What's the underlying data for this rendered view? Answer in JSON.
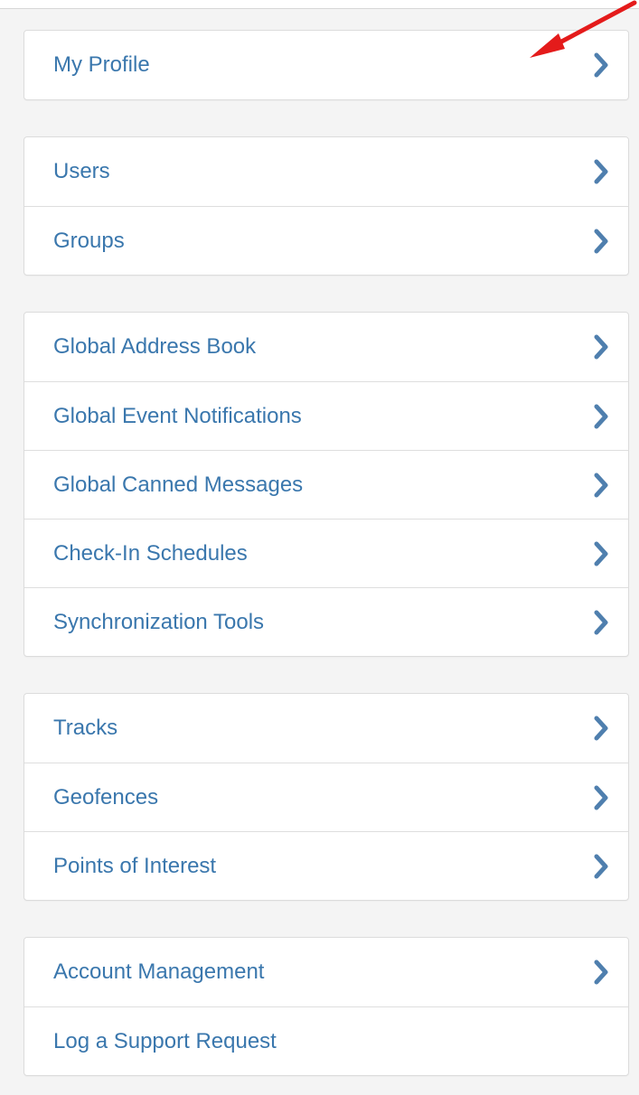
{
  "colors": {
    "link_text": "#3a77ad",
    "chevron": "#4f7fae",
    "annotation_arrow": "#e41b1b"
  },
  "groups": [
    {
      "items": [
        {
          "label": "My Profile",
          "has_chevron": true,
          "icon": "chevron-right-icon"
        }
      ]
    },
    {
      "items": [
        {
          "label": "Users",
          "has_chevron": true,
          "icon": "chevron-right-icon"
        },
        {
          "label": "Groups",
          "has_chevron": true,
          "icon": "chevron-right-icon"
        }
      ]
    },
    {
      "items": [
        {
          "label": "Global Address Book",
          "has_chevron": true,
          "icon": "chevron-right-icon"
        },
        {
          "label": "Global Event Notifications",
          "has_chevron": true,
          "icon": "chevron-right-icon"
        },
        {
          "label": "Global Canned Messages",
          "has_chevron": true,
          "icon": "chevron-right-icon"
        },
        {
          "label": "Check-In Schedules",
          "has_chevron": true,
          "icon": "chevron-right-icon"
        },
        {
          "label": "Synchronization Tools",
          "has_chevron": true,
          "icon": "chevron-right-icon"
        }
      ]
    },
    {
      "items": [
        {
          "label": "Tracks",
          "has_chevron": true,
          "icon": "chevron-right-icon"
        },
        {
          "label": "Geofences",
          "has_chevron": true,
          "icon": "chevron-right-icon"
        },
        {
          "label": "Points of Interest",
          "has_chevron": true,
          "icon": "chevron-right-icon"
        }
      ]
    },
    {
      "items": [
        {
          "label": "Account Management",
          "has_chevron": true,
          "icon": "chevron-right-icon"
        },
        {
          "label": "Log a Support Request",
          "has_chevron": false
        }
      ]
    }
  ]
}
